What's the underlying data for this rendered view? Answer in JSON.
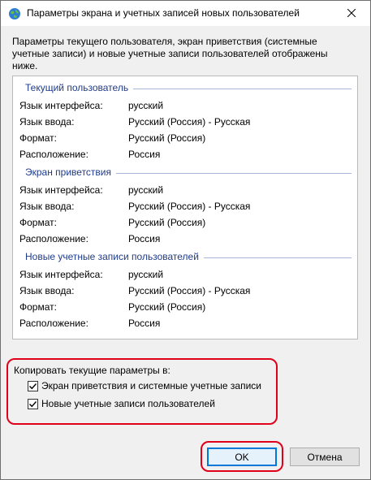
{
  "window": {
    "title": "Параметры экрана и учетных записей новых пользователей",
    "app_icon": "globe-icon",
    "close_icon": "close-icon"
  },
  "intro_text": "Параметры текущего пользователя, экран приветствия (системные учетные записи) и новые учетные записи пользователей отображены ниже.",
  "sections": [
    {
      "title": "Текущий пользователь",
      "rows": [
        {
          "key": "Язык интерфейса:",
          "value": "русский"
        },
        {
          "key": "Язык ввода:",
          "value": "Русский (Россия) - Русская"
        },
        {
          "key": "Формат:",
          "value": "Русский (Россия)"
        },
        {
          "key": "Расположение:",
          "value": "Россия"
        }
      ]
    },
    {
      "title": "Экран приветствия",
      "rows": [
        {
          "key": "Язык интерфейса:",
          "value": "русский"
        },
        {
          "key": "Язык ввода:",
          "value": "Русский (Россия) - Русская"
        },
        {
          "key": "Формат:",
          "value": "Русский (Россия)"
        },
        {
          "key": "Расположение:",
          "value": "Россия"
        }
      ]
    },
    {
      "title": "Новые учетные записи пользователей",
      "rows": [
        {
          "key": "Язык интерфейса:",
          "value": "русский"
        },
        {
          "key": "Язык ввода:",
          "value": "Русский (Россия) - Русская"
        },
        {
          "key": "Формат:",
          "value": "Русский (Россия)"
        },
        {
          "key": "Расположение:",
          "value": "Россия"
        }
      ]
    }
  ],
  "copy": {
    "label": "Копировать текущие параметры в:",
    "options": [
      {
        "label": "Экран приветствия и системные учетные записи",
        "checked": true
      },
      {
        "label": "Новые учетные записи пользователей",
        "checked": true
      }
    ]
  },
  "buttons": {
    "ok": "OK",
    "cancel": "Отмена"
  },
  "colors": {
    "highlight": "#e0001c",
    "section_title": "#1f3b8a",
    "ok_border": "#0078d7"
  }
}
